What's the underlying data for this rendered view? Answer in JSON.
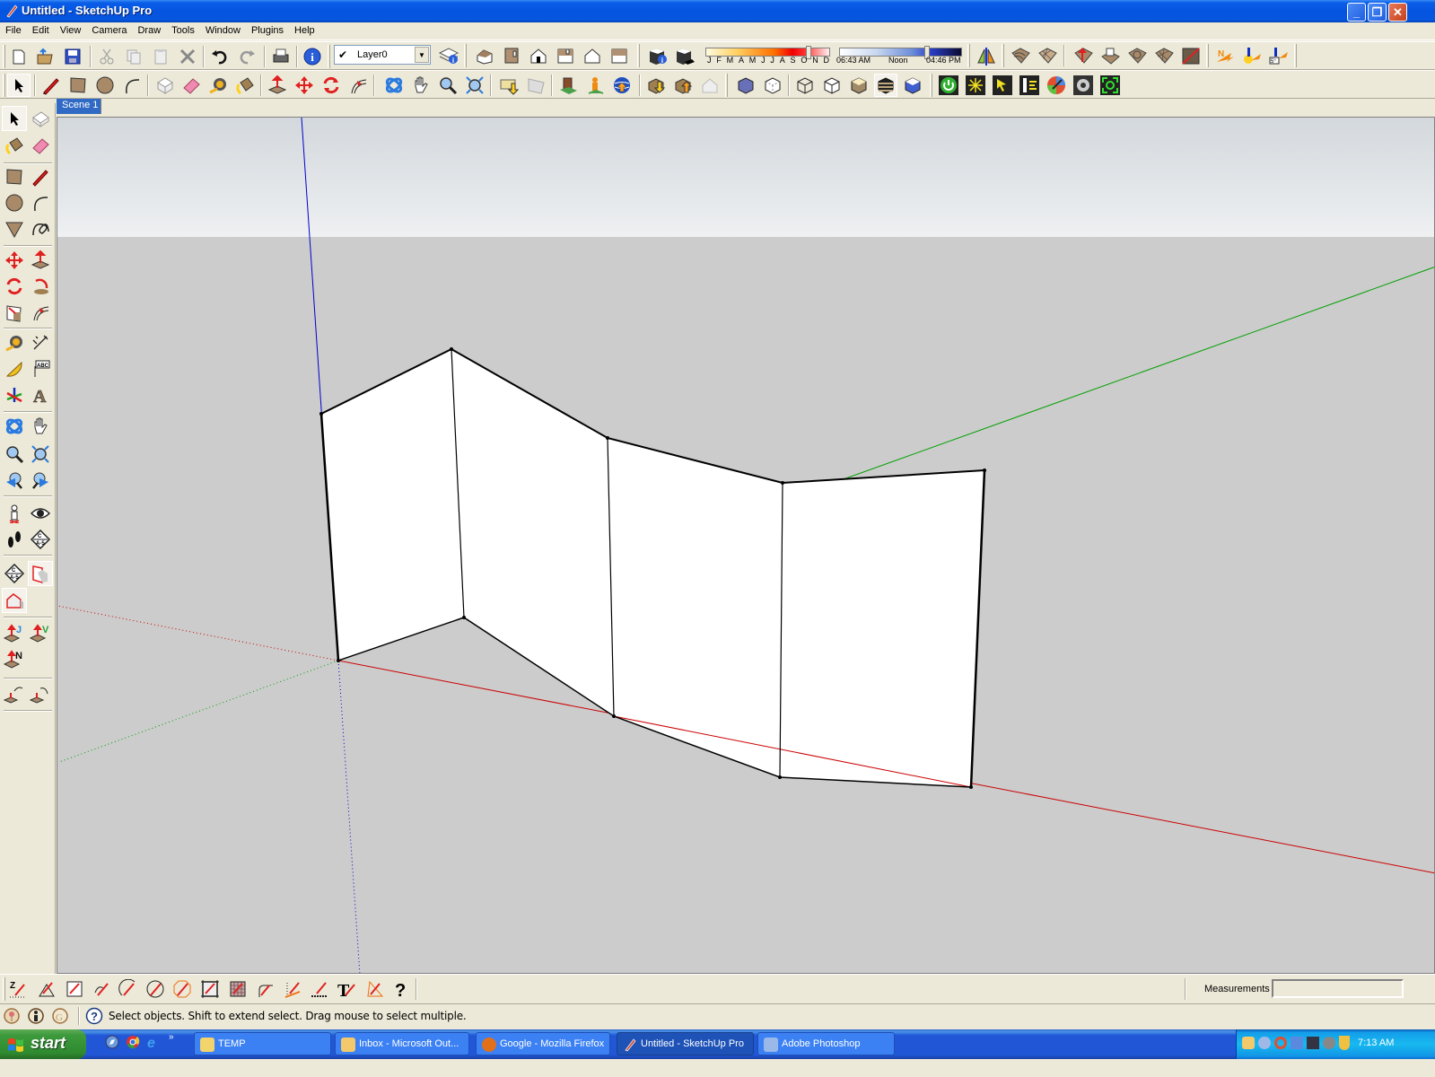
{
  "window": {
    "title": "Untitled - SketchUp Pro",
    "controls": [
      "minimize",
      "restore",
      "close"
    ]
  },
  "menu": [
    "File",
    "Edit",
    "View",
    "Camera",
    "Draw",
    "Tools",
    "Window",
    "Plugins",
    "Help"
  ],
  "toolbar_top": {
    "icons": [
      "new-icon",
      "open-icon",
      "save-icon",
      "cut-icon",
      "copy-icon",
      "paste-icon",
      "erase-icon",
      "undo-icon",
      "redo-icon",
      "print-icon",
      "model-info-icon"
    ],
    "layer": {
      "checked": "✔",
      "value": "Layer0"
    },
    "views": [
      "iso-view-icon",
      "top-view-icon",
      "front-view-icon",
      "right-view-icon",
      "back-view-icon",
      "left-view-icon"
    ],
    "shadow": {
      "months": [
        "J",
        "F",
        "M",
        "A",
        "M",
        "J",
        "J",
        "A",
        "S",
        "O",
        "N",
        "D"
      ],
      "month_value": "October",
      "time_start": "06:43 AM",
      "time_mid": "Noon",
      "time_end": "04:46 PM",
      "time_value_fraction": 0.68
    }
  },
  "toolbar_second": {
    "icons": [
      "select-icon",
      "pencil-icon",
      "rectangle-icon",
      "circle-icon",
      "arc-icon",
      "make-component-icon",
      "eraser-icon",
      "tape-measure-icon",
      "paint-bucket-icon",
      "push-pull-icon",
      "move-icon",
      "rotate-icon",
      "follow-me-icon",
      "orbit-icon",
      "pan-icon",
      "zoom-icon",
      "zoom-extents-icon",
      "get-models-icon",
      "share-model-icon",
      "place-model-icon",
      "get-current-view-icon",
      "toggle-terrain-icon",
      "share-component-icon",
      "get-photo-texture-icon",
      "xray-icon",
      "back-edges-icon",
      "wireframe-icon",
      "hidden-line-icon",
      "shaded-icon",
      "shaded-textures-icon",
      "monochrome-icon",
      "render-start-icon",
      "render-light-icon",
      "render-select-icon",
      "render-settings-icon",
      "render-material-icon",
      "render-options-icon",
      "render-screen-icon"
    ]
  },
  "scene_tab": "Scene 1",
  "left_toolbar": {
    "icons": [
      "select-icon",
      "make-component-icon",
      "paint-bucket-icon",
      "eraser-icon",
      "rectangle-icon",
      "line-icon",
      "circle-icon",
      "arc-icon",
      "polygon-icon",
      "freehand-icon",
      "move-icon",
      "push-pull-icon",
      "rotate-icon",
      "follow-me-icon",
      "scale-icon",
      "offset-icon",
      "tape-measure-icon",
      "dimension-icon",
      "protractor-icon",
      "text-icon",
      "axes-icon",
      "3d-text-icon",
      "orbit-icon",
      "pan-icon",
      "zoom-icon",
      "zoom-window-icon",
      "previous-view-icon",
      "next-view-icon",
      "position-camera-icon",
      "look-around-icon",
      "walk-icon",
      "section-plane-icon",
      "section-plane-2-icon",
      "display-section-planes-icon",
      "display-section-cuts-icon",
      "joint-push-pull-icon",
      "vector-push-pull-icon",
      "normal-push-pull-icon",
      "undo-push-pull-icon",
      "redo-push-pull-icon"
    ]
  },
  "bottom_toolbar": {
    "icons": [
      "z-line-icon",
      "draw-triangle-icon",
      "draw-square-icon",
      "draw-curve-icon",
      "draw-arc-icon",
      "draw-circle-icon",
      "draw-polygon-icon",
      "draw-grid-icon",
      "draw-mesh-icon",
      "draw-fillet-icon",
      "draw-parallel-icon",
      "draw-dashed-icon",
      "draw-text-icon",
      "draw-angle-icon",
      "help-icon"
    ],
    "measurements_label": "Measurements",
    "measurements_value": ""
  },
  "status": {
    "icons": [
      "geo-location-icon",
      "credits-icon",
      "google-icon",
      "help-icon"
    ],
    "text": "Select objects. Shift to extend select. Drag mouse to select multiple."
  },
  "taskbar": {
    "start": "start",
    "quicklaunch": [
      "safari-icon",
      "chrome-icon",
      "ie-icon"
    ],
    "tasks": [
      {
        "label": "TEMP",
        "icon_color": "#f3d36b",
        "active": false
      },
      {
        "label": "Inbox - Microsoft Out...",
        "icon_color": "#f3c96b",
        "active": false
      },
      {
        "label": "Google - Mozilla Firefox",
        "icon_color": "#e2701a",
        "active": false
      },
      {
        "label": "Untitled - SketchUp Pro",
        "icon_color": "#d84a2a",
        "active": true
      },
      {
        "label": "Adobe Photoshop",
        "icon_color": "#9ab8e8",
        "active": false
      }
    ],
    "clock": "7:13 AM"
  },
  "scene": {
    "axis_colors": {
      "red": "#cc0000",
      "green": "#00a000",
      "blue": "#0000cc"
    },
    "sky_color": "#d8dde0",
    "ground_color": "#cccccc",
    "face_color": "#ffffff",
    "edge_color": "#000000"
  }
}
